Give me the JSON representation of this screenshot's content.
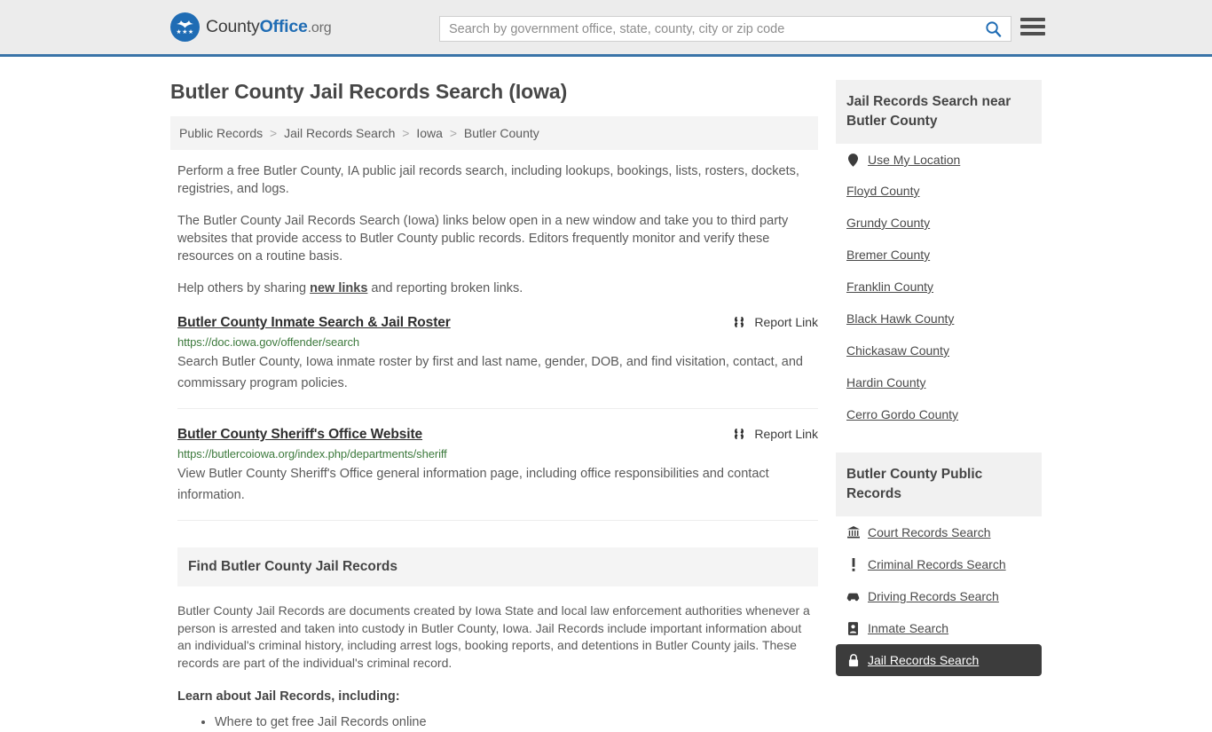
{
  "header": {
    "logo_text_1": "County",
    "logo_text_2": "Office",
    "logo_text_3": ".org",
    "search_placeholder": "Search by government office, state, county, city or zip code",
    "search_value": "",
    "search_icon": "search-icon",
    "menu_icon": "hamburger-menu-icon"
  },
  "page_title": "Butler County Jail Records Search (Iowa)",
  "breadcrumb": {
    "items": [
      "Public Records",
      "Jail Records Search",
      "Iowa",
      "Butler County"
    ],
    "separator": ">"
  },
  "intro": {
    "p1": "Perform a free Butler County, IA public jail records search, including lookups, bookings, lists, rosters, dockets, registries, and logs.",
    "p2": "The Butler County Jail Records Search (Iowa) links below open in a new window and take you to third party websites that provide access to Butler County public records. Editors frequently monitor and verify these resources on a routine basis.",
    "p3_before": "Help others by sharing ",
    "p3_link": "new links",
    "p3_after": " and reporting broken links."
  },
  "results": [
    {
      "title": "Butler County Inmate Search & Jail Roster",
      "url": "https://doc.iowa.gov/offender/search",
      "description": "Search Butler County, Iowa inmate roster by first and last name, gender, DOB, and find visitation, contact, and commissary program policies.",
      "report_label": "Report Link",
      "report_icon": "broken-link-icon"
    },
    {
      "title": "Butler County Sheriff's Office Website",
      "url": "https://butlercoiowa.org/index.php/departments/sheriff",
      "description": "View Butler County Sheriff's Office general information page, including office responsibilities and contact information.",
      "report_label": "Report Link",
      "report_icon": "broken-link-icon"
    }
  ],
  "find_section": {
    "heading": "Find Butler County Jail Records",
    "body": "Butler County Jail Records are documents created by Iowa State and local law enforcement authorities whenever a person is arrested and taken into custody in Butler County, Iowa. Jail Records include important information about an individual's criminal history, including arrest logs, booking reports, and detentions in Butler County jails. These records are part of the individual's criminal record.",
    "learn_heading": "Learn about Jail Records, including:",
    "learn_items": [
      "Where to get free Jail Records online"
    ]
  },
  "sidebar": {
    "near_heading": "Jail Records Search near Butler County",
    "use_my_location": {
      "label": "Use My Location",
      "icon": "map-pin-icon"
    },
    "nearby_counties": [
      "Floyd County",
      "Grundy County",
      "Bremer County",
      "Franklin County",
      "Black Hawk County",
      "Chickasaw County",
      "Hardin County",
      "Cerro Gordo County"
    ],
    "public_records_heading": "Butler County Public Records",
    "public_records_links": [
      {
        "label": "Court Records Search",
        "icon": "courthouse-icon",
        "active": false
      },
      {
        "label": "Criminal Records Search",
        "icon": "exclamation-icon",
        "active": false
      },
      {
        "label": "Driving Records Search",
        "icon": "car-icon",
        "active": false
      },
      {
        "label": "Inmate Search",
        "icon": "id-badge-icon",
        "active": false
      },
      {
        "label": "Jail Records Search",
        "icon": "lock-icon",
        "active": true
      }
    ]
  },
  "colors": {
    "brand_blue": "#1f6cb4",
    "header_border": "#3a74a8",
    "header_bg": "#ececec",
    "url_green": "#3d7a3d",
    "active_bg": "#3c3c3c",
    "panel_bg": "#f4f4f4"
  }
}
